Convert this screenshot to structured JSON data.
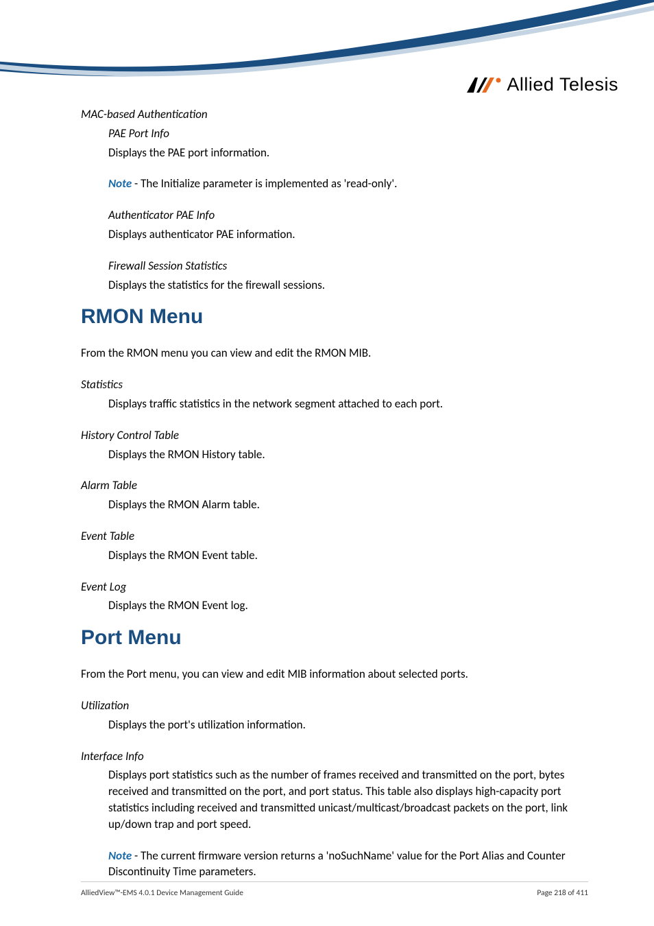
{
  "brand": {
    "name": "Allied Telesis"
  },
  "section1": {
    "heading_italic": "MAC-based Authentication",
    "pae_port_info_label": "PAE Port Info",
    "pae_port_info_desc": "Displays the PAE port information.",
    "note_prefix": "Note",
    "note_text": " - The Initialize parameter is implemented as 'read-only'.",
    "auth_pae_label": "Authenticator PAE Info",
    "auth_pae_desc": "Displays authenticator PAE information.",
    "firewall_label": "Firewall Session Statistics",
    "firewall_desc": "Displays the statistics for the firewall sessions."
  },
  "rmon": {
    "title": "RMON Menu",
    "intro": "From the RMON menu you can view and edit the RMON MIB.",
    "statistics_label": "Statistics",
    "statistics_desc": "Displays traffic statistics in the network segment attached to each port.",
    "history_label": "History Control Table",
    "history_desc": "Displays the RMON History table.",
    "alarm_label": "Alarm Table",
    "alarm_desc": "Displays the RMON Alarm table.",
    "event_table_label": "Event Table",
    "event_table_desc": "Displays the RMON Event table.",
    "event_log_label": "Event Log",
    "event_log_desc": "Displays the RMON Event log."
  },
  "port": {
    "title": "Port Menu",
    "intro": "From the Port menu, you can view and edit MIB information about selected ports.",
    "utilization_label": "Utilization",
    "utilization_desc": "Displays the port's utilization information.",
    "interface_label": "Interface Info",
    "interface_desc": "Displays port statistics such as the number of frames received and transmitted on the port, bytes received and transmitted on the port, and port status. This table also displays high-capacity port statistics including received and transmitted unicast/multicast/broadcast packets on the port, link up/down trap and port speed.",
    "note_prefix": "Note",
    "note_text": " - The current firmware version returns a 'noSuchName' value for the Port Alias and Counter Discontinuity Time parameters."
  },
  "footer": {
    "left": "AlliedView™-EMS 4.0.1 Device Management Guide",
    "right": "Page 218 of 411"
  }
}
